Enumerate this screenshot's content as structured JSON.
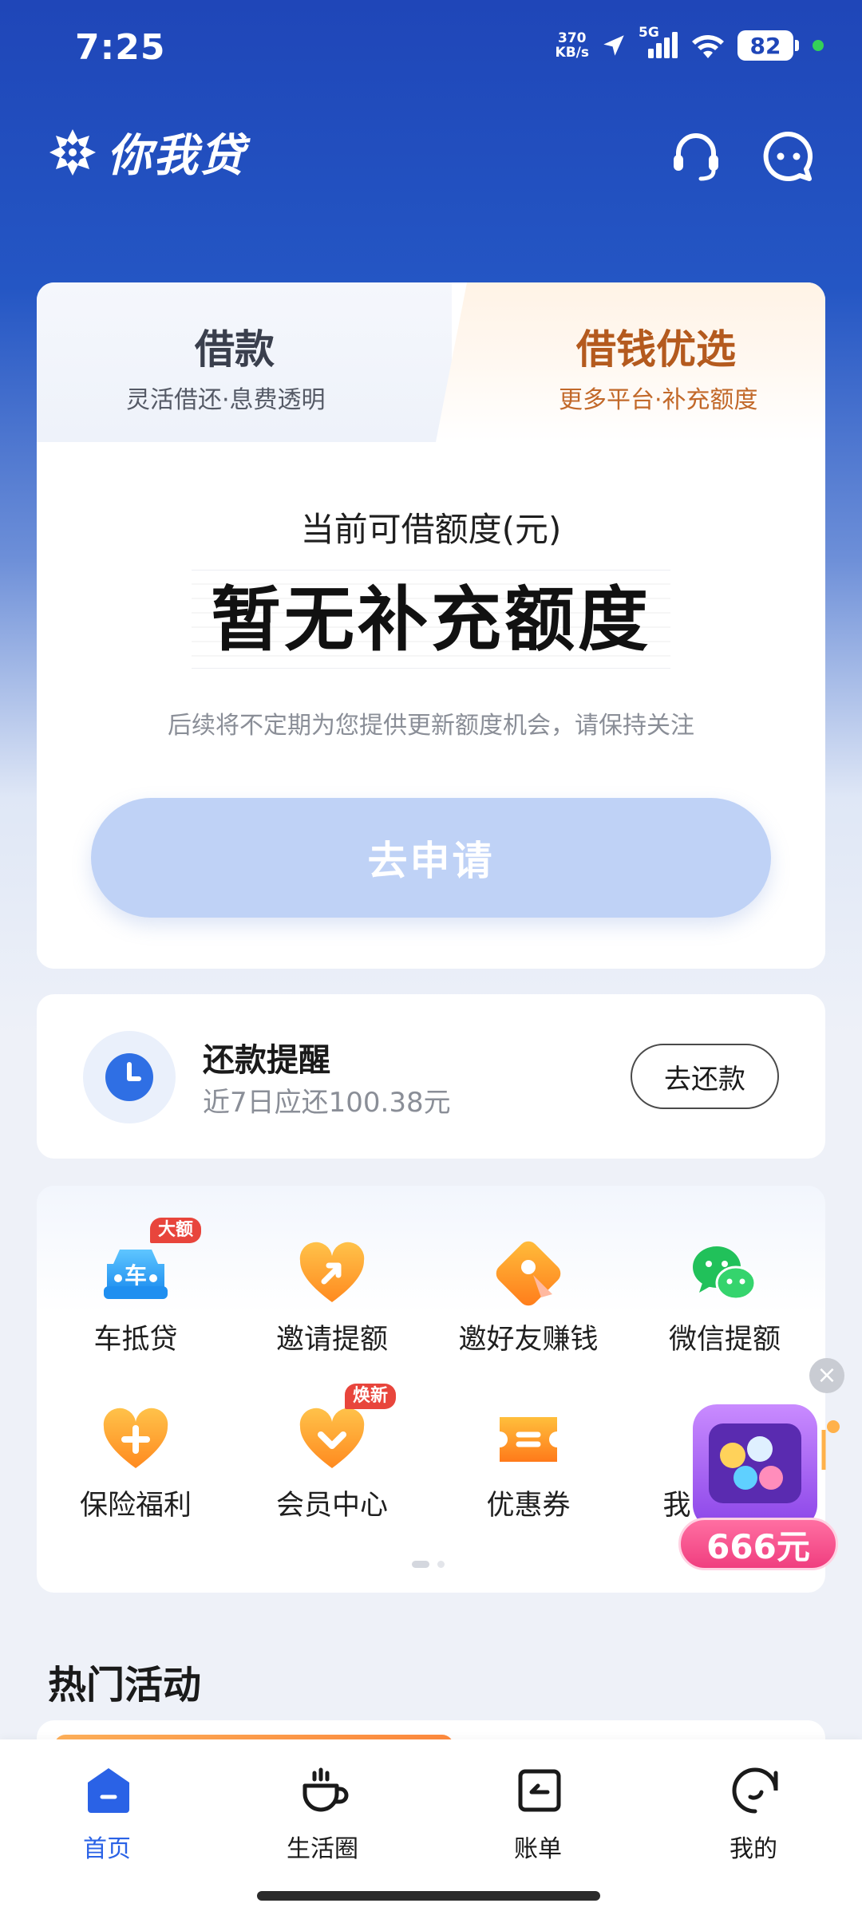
{
  "status_bar": {
    "time": "7:25",
    "net_speed_value": "370",
    "net_speed_unit": "KB/s",
    "network_type": "5G",
    "battery": "82"
  },
  "header": {
    "app_name": "你我贷"
  },
  "loan_card": {
    "tabs": [
      {
        "title": "借款",
        "subtitle": "灵活借还·息费透明"
      },
      {
        "title": "借钱优选",
        "subtitle": "更多平台·补充额度"
      }
    ],
    "quota_label": "当前可借额度(元)",
    "quota_value": "暂无补充额度",
    "note": "后续将不定期为您提供更新额度机会，请保持关注",
    "apply_label": "去申请"
  },
  "repayment": {
    "title": "还款提醒",
    "subtitle": "近7日应还100.38元",
    "button_label": "去还款"
  },
  "services": {
    "items": [
      {
        "label": "车抵贷",
        "badge": "大额",
        "icon": "car-icon"
      },
      {
        "label": "邀请提额",
        "icon": "heart-arrow-icon"
      },
      {
        "label": "邀好友赚钱",
        "icon": "coin-diamond-icon"
      },
      {
        "label": "微信提额",
        "icon": "wechat-icon"
      },
      {
        "label": "保险福利",
        "icon": "heart-plus-icon"
      },
      {
        "label": "会员中心",
        "badge": "焕新",
        "icon": "heart-chevron-icon"
      },
      {
        "label": "优惠券",
        "icon": "coupon-icon"
      },
      {
        "label": "我",
        "icon": "partially-hidden-icon"
      }
    ]
  },
  "promo": {
    "amount": "666元"
  },
  "hot_activities": {
    "title": "热门活动"
  },
  "bottom_nav": {
    "items": [
      {
        "label": "首页",
        "active": true
      },
      {
        "label": "生活圈"
      },
      {
        "label": "账单"
      },
      {
        "label": "我的"
      }
    ]
  },
  "colors": {
    "brand_blue": "#2456c4",
    "accent_blue": "#2a62e6",
    "apply_button": "#bfd2f6",
    "badge_red": "#e8453c",
    "orange": "#ff8a1f"
  }
}
